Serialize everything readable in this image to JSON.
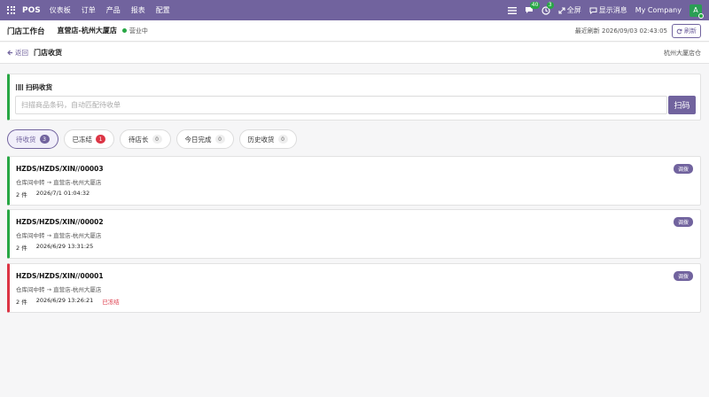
{
  "topbar": {
    "brand": "POS",
    "nav": [
      "仪表板",
      "订单",
      "产品",
      "报表",
      "配置"
    ],
    "chat_count": "40",
    "activity_count": "3",
    "fullscreen_label": "全屏",
    "messages_label": "显示消息",
    "company": "My Company",
    "avatar_letter": "A",
    "accent_color": "#71639e"
  },
  "subbar": {
    "title": "门店工作台",
    "store": "直营店-杭州大厦店",
    "status": "营业中",
    "refresh_time": "最近刷新 2026/09/03 02:43:05",
    "refresh_label": "刷新"
  },
  "crumb": {
    "back_label": "返回",
    "title": "门店收货",
    "location": "杭州大厦店仓"
  },
  "scan": {
    "title": "扫码收货",
    "placeholder": "扫描商品条码，自动匹配待收单",
    "button_label": "扫码"
  },
  "tabs": [
    {
      "label": "待收货",
      "count": "3"
    },
    {
      "label": "已冻结",
      "count": "1"
    },
    {
      "label": "待店长",
      "count": "0"
    },
    {
      "label": "今日完成",
      "count": "0"
    },
    {
      "label": "历史收货",
      "count": "0"
    }
  ],
  "orders": [
    {
      "code": "HZDS/HZDS/XIN//00003",
      "route": "仓库间中转 → 直营店-杭州大厦店",
      "qty": "2 件",
      "time": "2026/7/1 01:04:32",
      "frozen": "",
      "tag": "调拨"
    },
    {
      "code": "HZDS/HZDS/XIN//00002",
      "route": "仓库间中转 → 直营店-杭州大厦店",
      "qty": "2 件",
      "time": "2026/6/29 13:31:25",
      "frozen": "",
      "tag": "调拨"
    },
    {
      "code": "HZDS/HZDS/XIN//00001",
      "route": "仓库间中转 → 直营店-杭州大厦店",
      "qty": "2 件",
      "time": "2026/6/29 13:26:21",
      "frozen": "已冻结",
      "tag": "调拨"
    }
  ]
}
